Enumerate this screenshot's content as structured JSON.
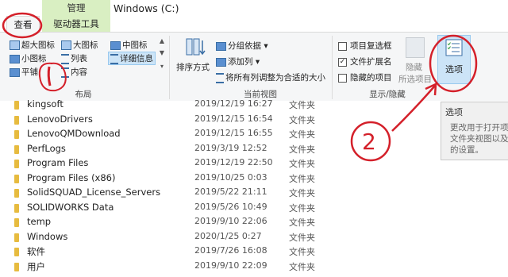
{
  "window": {
    "manage_tab": "管理",
    "title": "Windows (C:)"
  },
  "tabs": {
    "view": "查看",
    "drive_tools": "驱动器工具"
  },
  "layout_group": {
    "label": "布局",
    "items": {
      "extra_large": "超大图标",
      "large": "大图标",
      "medium": "中图标",
      "small": "小图标",
      "list": "列表",
      "details": "详细信息",
      "tiles": "平铺",
      "content": "内容"
    }
  },
  "current_view_group": {
    "label": "当前视图",
    "sort_by": "排序方式",
    "group_by": "分组依据",
    "add_columns": "添加列",
    "size_all_columns": "将所有列调整为合适的大小"
  },
  "show_hide_group": {
    "label": "显示/隐藏",
    "item_checkboxes": {
      "label": "项目复选框",
      "checked": false
    },
    "file_extensions": {
      "label": "文件扩展名",
      "checked": true
    },
    "hidden_items": {
      "label": "隐藏的项目",
      "checked": false
    },
    "hide_selected_line1": "隐藏",
    "hide_selected_line2": "所选项目"
  },
  "options_button": "选项",
  "tooltip": {
    "title": "选项",
    "body": "更改用于打开项\n文件夹视图以及\n的设置。"
  },
  "files": [
    {
      "name": "kingsoft",
      "date": "2019/12/19 16:27",
      "type": "文件夹"
    },
    {
      "name": "LenovoDrivers",
      "date": "2019/12/15 16:54",
      "type": "文件夹"
    },
    {
      "name": "LenovoQMDownload",
      "date": "2019/12/15 16:55",
      "type": "文件夹"
    },
    {
      "name": "PerfLogs",
      "date": "2019/3/19 12:52",
      "type": "文件夹"
    },
    {
      "name": "Program Files",
      "date": "2019/12/19 22:50",
      "type": "文件夹"
    },
    {
      "name": "Program Files (x86)",
      "date": "2019/10/25 0:03",
      "type": "文件夹"
    },
    {
      "name": "SolidSQUAD_License_Servers",
      "date": "2019/5/22 21:11",
      "type": "文件夹"
    },
    {
      "name": "SOLIDWORKS Data",
      "date": "2019/5/26 10:49",
      "type": "文件夹"
    },
    {
      "name": "temp",
      "date": "2019/9/10 22:06",
      "type": "文件夹"
    },
    {
      "name": "Windows",
      "date": "2020/1/25 0:27",
      "type": "文件夹"
    },
    {
      "name": "软件",
      "date": "2019/7/26 16:08",
      "type": "文件夹"
    },
    {
      "name": "用户",
      "date": "2019/9/10 22:09",
      "type": "文件夹"
    }
  ],
  "annotation_label": "2",
  "colors": {
    "annotation": "#d4202a",
    "folder": "#e7bb3f",
    "selection": "#cce4f7",
    "manage_tab": "#d9efc2"
  }
}
